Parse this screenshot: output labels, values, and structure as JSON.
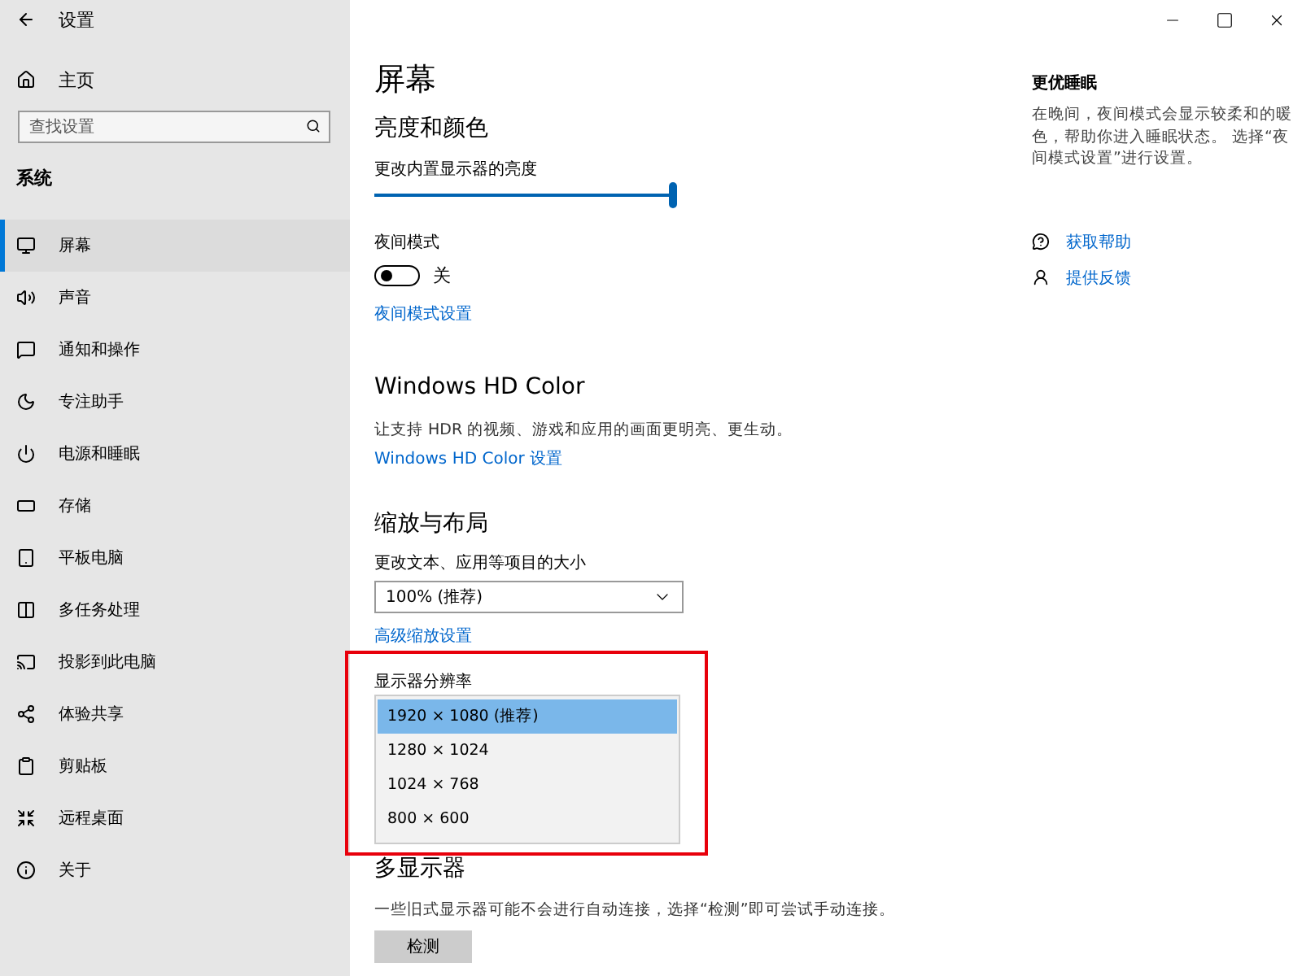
{
  "window": {
    "title": "设置"
  },
  "sidebar": {
    "home": "主页",
    "search": {
      "placeholder": "查找设置"
    },
    "section": "系统",
    "items": [
      {
        "label": "屏幕",
        "selected": true
      },
      {
        "label": "声音",
        "selected": false
      },
      {
        "label": "通知和操作",
        "selected": false
      },
      {
        "label": "专注助手",
        "selected": false
      },
      {
        "label": "电源和睡眠",
        "selected": false
      },
      {
        "label": "存储",
        "selected": false
      },
      {
        "label": "平板电脑",
        "selected": false
      },
      {
        "label": "多任务处理",
        "selected": false
      },
      {
        "label": "投影到此电脑",
        "selected": false
      },
      {
        "label": "体验共享",
        "selected": false
      },
      {
        "label": "剪贴板",
        "selected": false
      },
      {
        "label": "远程桌面",
        "selected": false
      },
      {
        "label": "关于",
        "selected": false
      }
    ]
  },
  "main": {
    "title": "屏幕",
    "brightness": {
      "heading": "亮度和颜色",
      "label": "更改内置显示器的亮度",
      "level": 0.99,
      "night_label": "夜间模式",
      "night_on": false,
      "night_state": "关",
      "link": "夜间模式设置"
    },
    "hdr": {
      "heading": "Windows HD Color",
      "description": "让支持 HDR 的视频、游戏和应用的画面更明亮、更生动。",
      "link": "Windows HD Color 设置"
    },
    "scale": {
      "heading": "缩放与布局",
      "label": "更改文本、应用等项目的大小",
      "value": "100% (推荐)",
      "link": "高级缩放设置"
    },
    "resolution": {
      "label": "显示器分辨率",
      "highlighted": true,
      "options": [
        {
          "label": "1920 × 1080 (推荐)",
          "selected": true
        },
        {
          "label": "1280 × 1024",
          "selected": false
        },
        {
          "label": "1024 × 768",
          "selected": false
        },
        {
          "label": "800 × 600",
          "selected": false
        }
      ]
    },
    "multi": {
      "heading": "多显示器",
      "description": "一些旧式显示器可能不会进行自动连接，选择“检测”即可尝试手动连接。",
      "button": "检测"
    }
  },
  "aside": {
    "heading": "更优睡眠",
    "text": "在晚间，夜间模式会显示较柔和的暖色，帮助你进入睡眠状态。 选择“夜间模式设置”进行设置。",
    "links": [
      "获取帮助",
      "提供反馈"
    ]
  }
}
